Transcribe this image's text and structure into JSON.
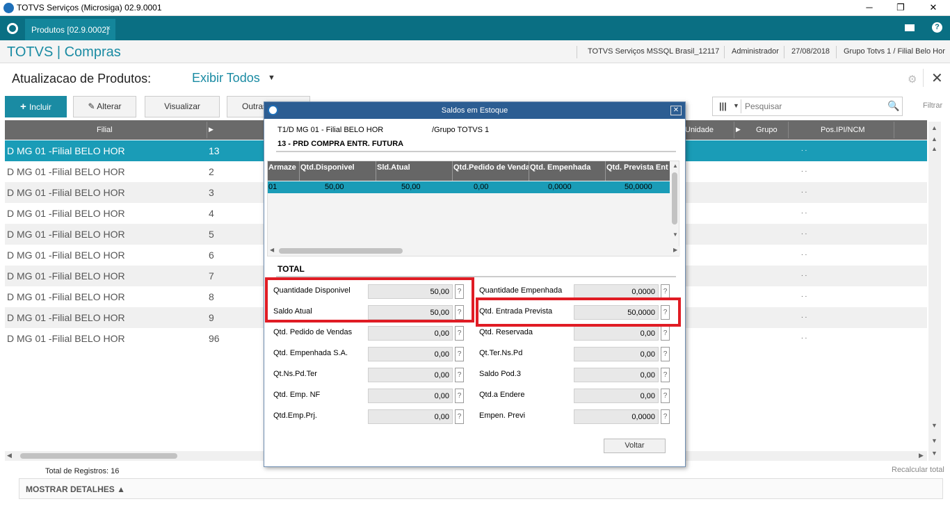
{
  "window": {
    "title": "TOTVS Serviços (Microsiga) 02.9.0001",
    "minimize": "─",
    "maximize": "❐",
    "close": "✕"
  },
  "tab": {
    "label": "Produtos [02.9.0002]",
    "close": "×"
  },
  "header": {
    "brand": "TOTVS | Compras",
    "environment": "TOTVS Serviços MSSQL Brasil_12117",
    "user": "Administrador",
    "date": "27/08/2018",
    "company": "Grupo Totvs 1 / Filial Belo Hor"
  },
  "page": {
    "title": "Atualizacao de Produtos:",
    "filter": "Exibir Todos"
  },
  "toolbar": {
    "incluir": "Incluir",
    "alterar": "Alterar",
    "visualizar": "Visualizar",
    "outras": "Outras",
    "search_placeholder": "Pesquisar",
    "filtrar": "Filtrar"
  },
  "grid": {
    "columns": {
      "filial": "Filial",
      "unidade": "Unidade",
      "grupo": "Grupo",
      "pos_ipi": "Pos.IPI/NCM"
    },
    "rows": [
      {
        "filial": "D MG 01 -Filial BELO HOR",
        "code": "13",
        "ncm": ". ."
      },
      {
        "filial": "D MG 01 -Filial BELO HOR",
        "code": "2",
        "ncm": ". ."
      },
      {
        "filial": "D MG 01 -Filial BELO HOR",
        "code": "3",
        "ncm": ". ."
      },
      {
        "filial": "D MG 01 -Filial BELO HOR",
        "code": "4",
        "ncm": ". ."
      },
      {
        "filial": "D MG 01 -Filial BELO HOR",
        "code": "5",
        "ncm": ". ."
      },
      {
        "filial": "D MG 01 -Filial BELO HOR",
        "code": "6",
        "ncm": ". ."
      },
      {
        "filial": "D MG 01 -Filial BELO HOR",
        "code": "7",
        "ncm": ". ."
      },
      {
        "filial": "D MG 01 -Filial BELO HOR",
        "code": "8",
        "ncm": ". ."
      },
      {
        "filial": "D MG 01 -Filial BELO HOR",
        "code": "9",
        "ncm": ". ."
      },
      {
        "filial": "D MG 01 -Filial BELO HOR",
        "code": "96",
        "ncm": ". ."
      }
    ]
  },
  "footer": {
    "total": "Total de Registros: 16",
    "recalcular": "Recalcular total",
    "detalhes": "MOSTRAR DETALHES ▲"
  },
  "dialog": {
    "title": "Saldos em Estoque",
    "filial": "T1/D MG 01  - Filial BELO HOR",
    "grupo": "/Grupo TOTVS 1",
    "produto": "13 - PRD COMPRA ENTR. FUTURA",
    "table_columns": [
      "Armaze",
      "Qtd.Disponivel",
      "Sld.Atual",
      "Qtd.Pedido de Venda",
      "Qtd. Empenhada",
      "Qtd. Prevista Ent"
    ],
    "table_row": [
      "01",
      "50,00",
      "50,00",
      "0,00",
      "0,0000",
      "50,0000"
    ],
    "total_label": "TOTAL",
    "left_fields": [
      {
        "label": "Quantidade Disponivel",
        "value": "50,00"
      },
      {
        "label": "Saldo Atual",
        "value": "50,00"
      },
      {
        "label": "Qtd. Pedido de Vendas",
        "value": "0,00"
      },
      {
        "label": "Qtd. Empenhada S.A.",
        "value": "0,00"
      },
      {
        "label": "Qt.Ns.Pd.Ter",
        "value": "0,00"
      },
      {
        "label": "Qtd. Emp. NF",
        "value": "0,00"
      },
      {
        "label": "Qtd.Emp.Prj.",
        "value": "0,00"
      }
    ],
    "right_fields": [
      {
        "label": "Quantidade Empenhada",
        "value": "0,0000"
      },
      {
        "label": "Qtd. Entrada Prevista",
        "value": "50,0000"
      },
      {
        "label": "Qtd. Reservada",
        "value": "0,00"
      },
      {
        "label": "Qt.Ter.Ns.Pd",
        "value": "0,00"
      },
      {
        "label": "Saldo Pod.3",
        "value": "0,00"
      },
      {
        "label": "Qtd.a Endere",
        "value": "0,00"
      },
      {
        "label": "Empen. Previ",
        "value": "0,0000"
      }
    ],
    "help": "?",
    "voltar": "Voltar"
  },
  "colors": {
    "teal": "#0a6f83",
    "accent": "#1a8ba3",
    "selected_row": "#1a9cb7",
    "highlight_box": "#e01c24",
    "dialog_title": "#2c5d92"
  }
}
